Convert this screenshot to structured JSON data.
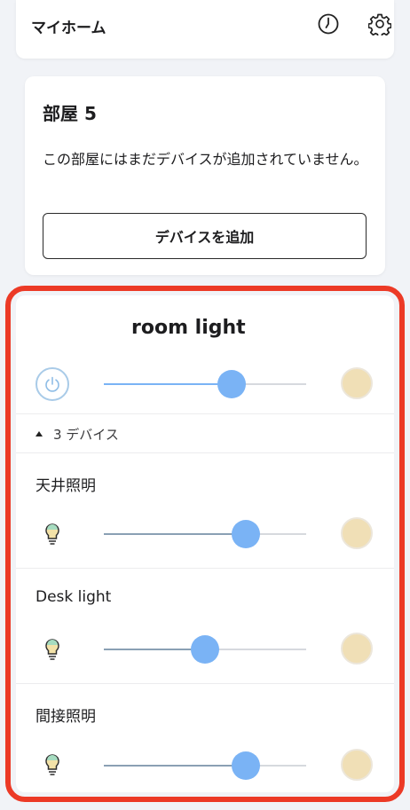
{
  "header": {
    "title": "マイホーム",
    "icons": [
      "history-clock-icon",
      "settings-gear-icon"
    ]
  },
  "room": {
    "title": "部屋 5",
    "empty_message": "この部屋にはまだデバイスが追加されていません。",
    "add_button_label": "デバイスを追加"
  },
  "group": {
    "title_visible_part": "room light",
    "title_redacted": true,
    "power": "on",
    "brightness": 0.63,
    "accent_color": "#7ab3f5",
    "light_color": "#f0dfb6",
    "devices_toggle_label": "3 デバイス",
    "devices": [
      {
        "name": "天井照明",
        "brightness": 0.7
      },
      {
        "name": "Desk light",
        "brightness": 0.5
      },
      {
        "name": "間接照明",
        "brightness": 0.7
      }
    ]
  },
  "annotation": {
    "outline_color": "#ec3a26"
  }
}
